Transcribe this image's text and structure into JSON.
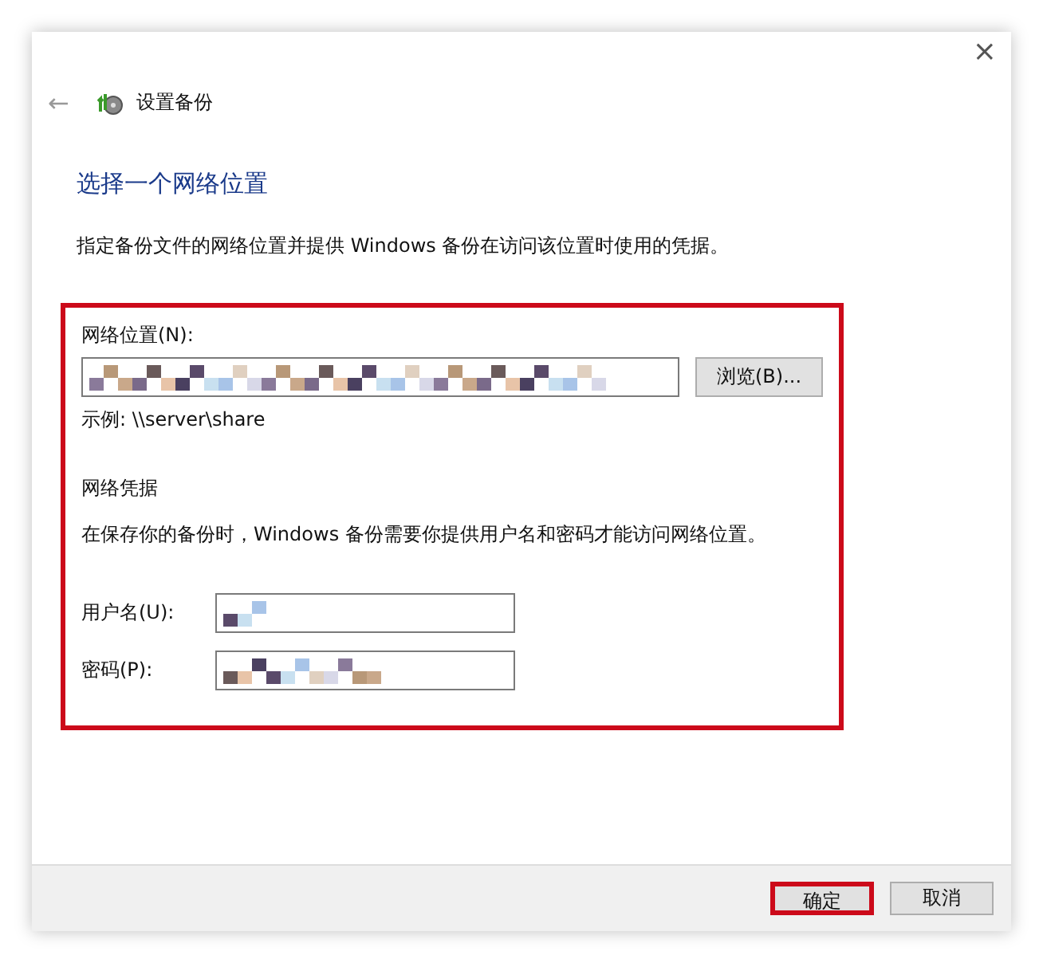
{
  "window": {
    "close": "×",
    "back": "←",
    "title": "设置备份"
  },
  "heading": "选择一个网络位置",
  "description": "指定备份文件的网络位置并提供 Windows 备份在访问该位置时使用的凭据。",
  "section": {
    "highlighted": true,
    "location_label": "网络位置(N):",
    "location_field": {
      "value_hidden": true
    },
    "browse_button": "浏览(B)...",
    "example": "示例: \\\\server\\share",
    "credentials_heading": "网络凭据",
    "credentials_note": "在保存你的备份时，Windows 备份需要你提供用户名和密码才能访问网络位置。",
    "fields": [
      {
        "label": "用户名(U):",
        "value_hidden": true
      },
      {
        "label": "密码(P):",
        "value_hidden": true
      }
    ]
  },
  "buttons": [
    {
      "label": "确定",
      "highlighted": true
    },
    {
      "label": "取消",
      "highlighted": false
    }
  ]
}
